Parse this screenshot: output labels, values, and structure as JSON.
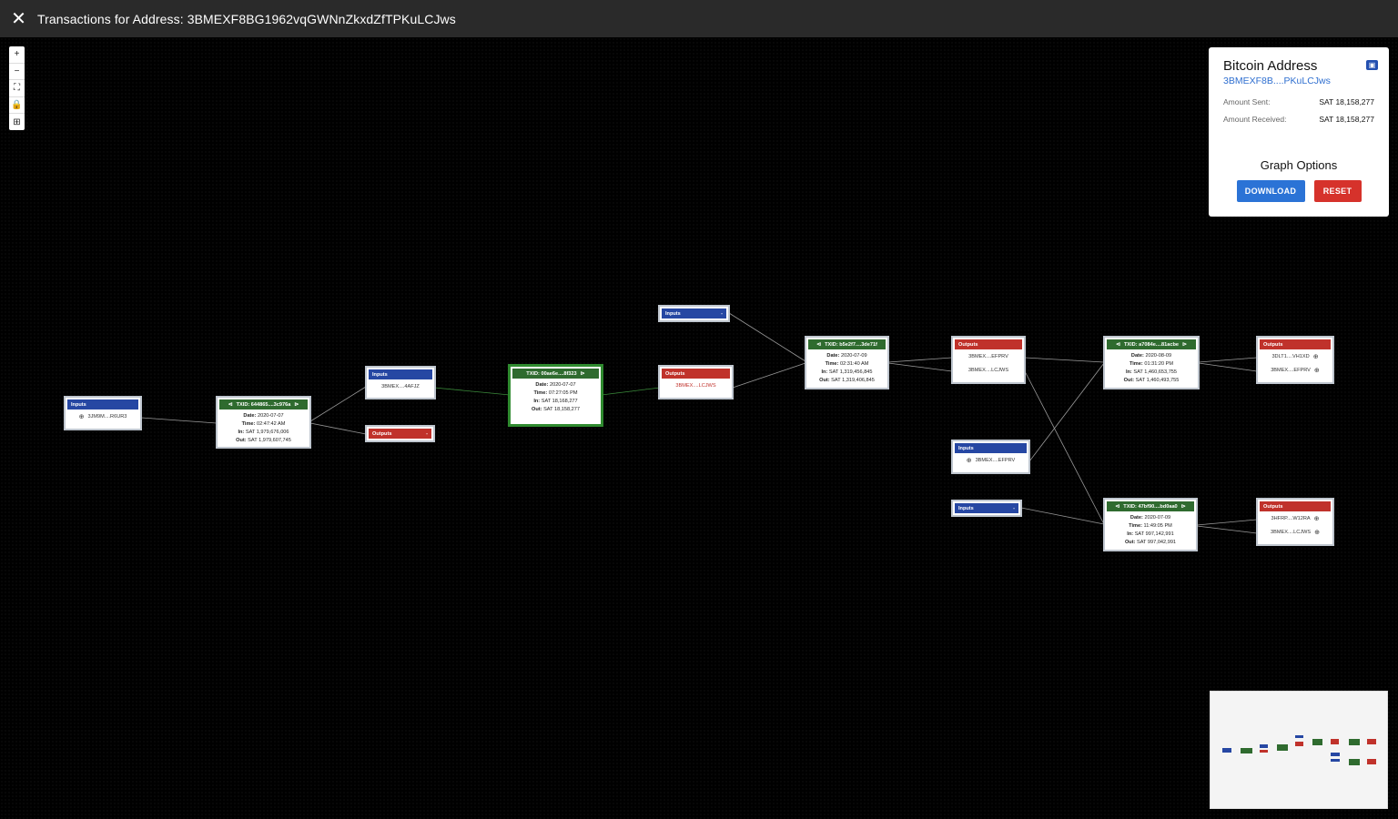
{
  "header": {
    "close_icon": "close-icon",
    "title": "Transactions for Address: 3BMEXF8BG1962vqGWNnZkxdZfTPKuLCJws"
  },
  "controls": {
    "zoom_in": "+",
    "zoom_out": "−",
    "fit": "⛶",
    "lock": "🔒",
    "map": "⊞"
  },
  "nodes": {
    "in1": {
      "label": "Inputs",
      "addr": "3JM9M....R6UR3"
    },
    "tx1": {
      "txid": "TXID: 644865....3c976a",
      "date": "2020-07-07",
      "time": "02:47:42 AM",
      "in": "SAT 1,979,676,006",
      "out": "SAT 1,979,607,745"
    },
    "in2": {
      "label": "Inputs",
      "addr": "3BMEX....4AFJZ"
    },
    "out2": {
      "label": "Outputs",
      "toggle": "-"
    },
    "tx2": {
      "txid": "TXID: 00ae6e....8f323",
      "date": "2020-07-07",
      "time": "07:27:05 PM",
      "in": "SAT 18,168,277",
      "out": "SAT 18,158,277"
    },
    "in3": {
      "label": "Inputs",
      "toggle": "-"
    },
    "out3": {
      "label": "Outputs",
      "addr": "3BMEX....LCJWS"
    },
    "tx3": {
      "txid": "TXID: b5e2f7....3de71f",
      "date": "2020-07-09",
      "time": "02:31:40 AM",
      "in": "SAT 1,319,456,845",
      "out": "SAT 1,319,406,845"
    },
    "out4": {
      "label": "Outputs",
      "addr1": "3BMEX....EFPRV",
      "addr2": "3BMEX....LCJWS"
    },
    "in4": {
      "label": "Inputs",
      "addr": "3BMEX....EFPRV"
    },
    "in5": {
      "label": "Inputs",
      "toggle": "-"
    },
    "tx4": {
      "txid": "TXID: a7084e....81acbe",
      "date": "2020-08-09",
      "time": "01:31:20 PM",
      "in": "SAT 1,460,653,755",
      "out": "SAT 1,460,493,755"
    },
    "tx5": {
      "txid": "TXID: 47bf90....bd0aa0",
      "date": "2020-07-09",
      "time": "11:49:05 PM",
      "in": "SAT 997,142,991",
      "out": "SAT 997,042,991"
    },
    "out5": {
      "label": "Outputs",
      "addr1": "3DLT1....VH1XD",
      "addr2": "3BMEX....EFPRV"
    },
    "out6": {
      "label": "Outputs",
      "addr1": "3HFRP....W12RA",
      "addr2": "3BMEX....LCJWS"
    }
  },
  "labels": {
    "date": "Date:",
    "time": "Time:",
    "in": "In:",
    "out": "Out:"
  },
  "panel": {
    "title": "Bitcoin Address",
    "address": "3BMEXF8B....PKuLCJws",
    "amount_sent_label": "Amount Sent:",
    "amount_sent": "SAT 18,158,277",
    "amount_received_label": "Amount Received:",
    "amount_received": "SAT 18,158,277",
    "graph_options": "Graph Options",
    "download": "DOWNLOAD",
    "reset": "RESET"
  },
  "colors": {
    "input": "#2647a3",
    "output": "#c0322b",
    "tx": "#2f6b2f",
    "link": "#2f6fd0"
  }
}
